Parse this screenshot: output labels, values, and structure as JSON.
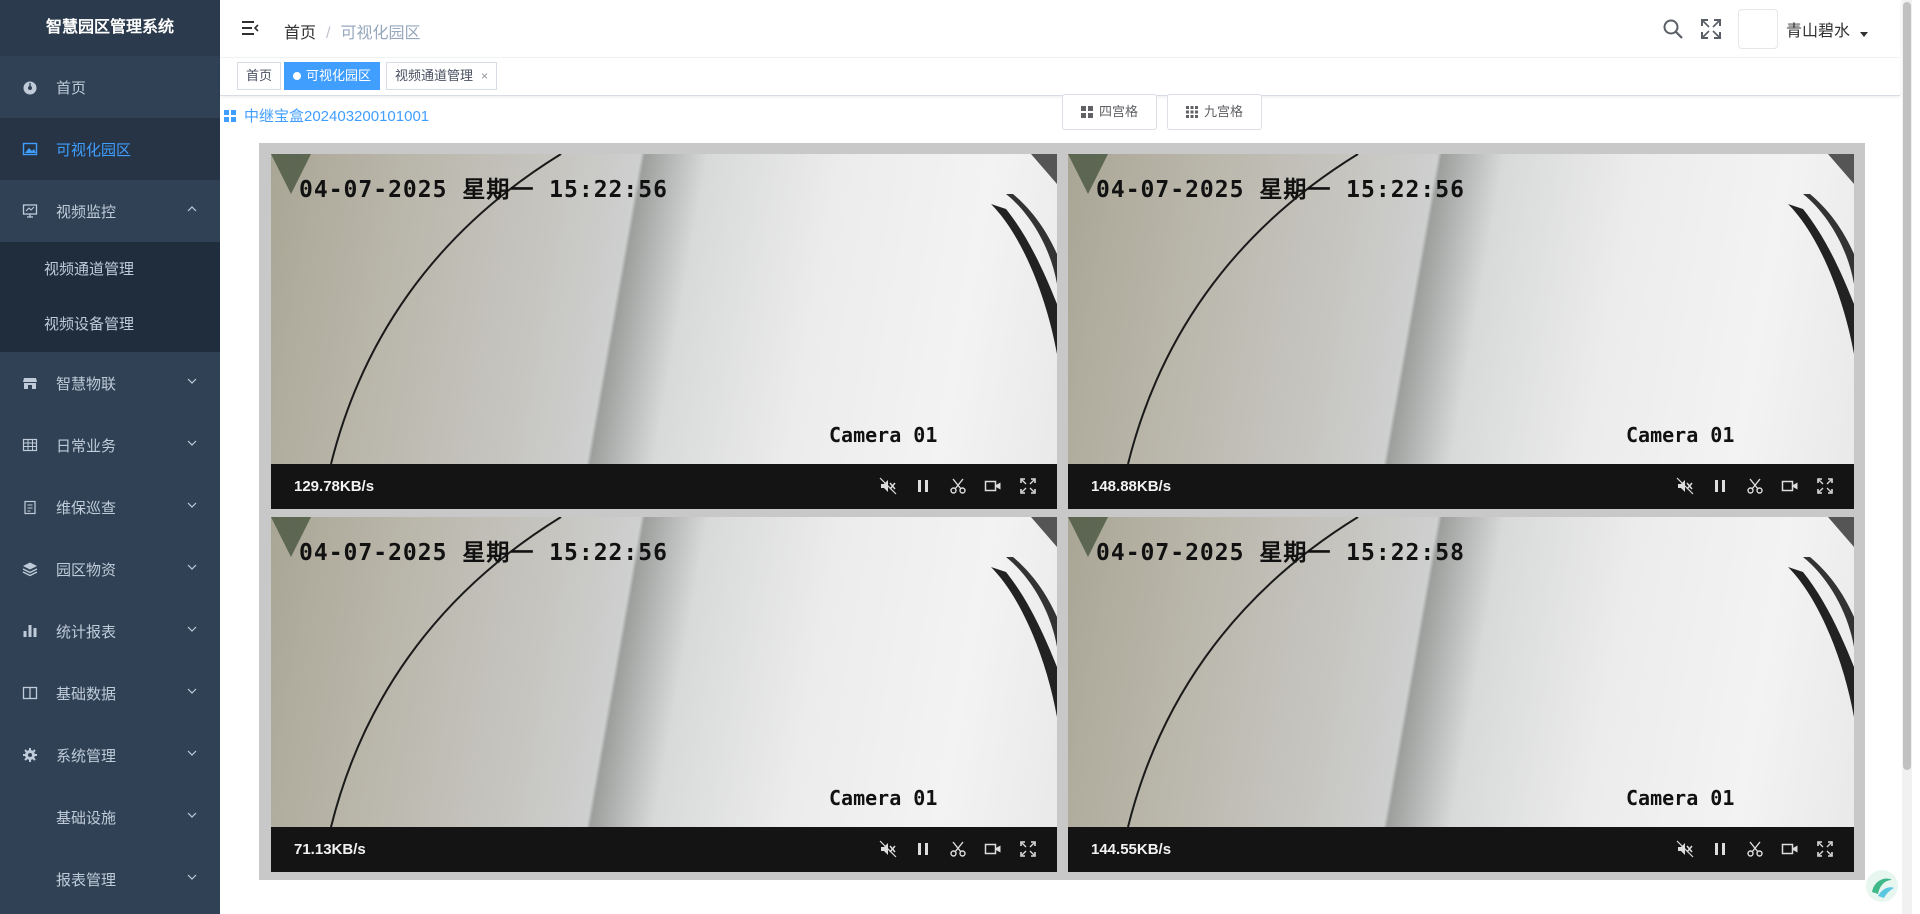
{
  "app": {
    "title": "智慧园区管理系统"
  },
  "sidebar": {
    "items": [
      {
        "label": "首页",
        "icon": "dashboard-icon"
      },
      {
        "label": "可视化园区",
        "icon": "picture-icon",
        "active": true
      },
      {
        "label": "视频监控",
        "icon": "monitor-icon",
        "expanded": true
      },
      {
        "label": "智慧物联",
        "icon": "shop-icon"
      },
      {
        "label": "日常业务",
        "icon": "table-icon"
      },
      {
        "label": "维保巡查",
        "icon": "clipboard-icon"
      },
      {
        "label": "园区物资",
        "icon": "layers-icon"
      },
      {
        "label": "统计报表",
        "icon": "bar-chart-icon"
      },
      {
        "label": "基础数据",
        "icon": "columns-icon"
      },
      {
        "label": "系统管理",
        "icon": "gear-icon"
      },
      {
        "label": "基础设施",
        "icon": ""
      },
      {
        "label": "报表管理",
        "icon": ""
      }
    ],
    "submenu": [
      "视频通道管理",
      "视频设备管理"
    ]
  },
  "header": {
    "breadcrumb": [
      "首页",
      "可视化园区"
    ],
    "username": "青山碧水"
  },
  "tags": [
    {
      "label": "首页"
    },
    {
      "label": "可视化园区",
      "active": true
    },
    {
      "label": "视频通道管理",
      "closable": true,
      "close": "×"
    }
  ],
  "main": {
    "device_title": "中继宝盒202403200101001",
    "layout_buttons": [
      "四宫格",
      "九宫格"
    ],
    "cameras": [
      {
        "timestamp": "04-07-2025 星期一 15:22:56",
        "label": "Camera 01",
        "speed": "129.78KB/s"
      },
      {
        "timestamp": "04-07-2025 星期一 15:22:56",
        "label": "Camera 01",
        "speed": "148.88KB/s"
      },
      {
        "timestamp": "04-07-2025 星期一 15:22:56",
        "label": "Camera 01",
        "speed": "71.13KB/s"
      },
      {
        "timestamp": "04-07-2025 星期一 15:22:58",
        "label": "Camera 01",
        "speed": "144.55KB/s"
      }
    ]
  },
  "colors": {
    "sidebar_bg": "#304156",
    "accent": "#409eff",
    "control_bar": "#141414"
  }
}
